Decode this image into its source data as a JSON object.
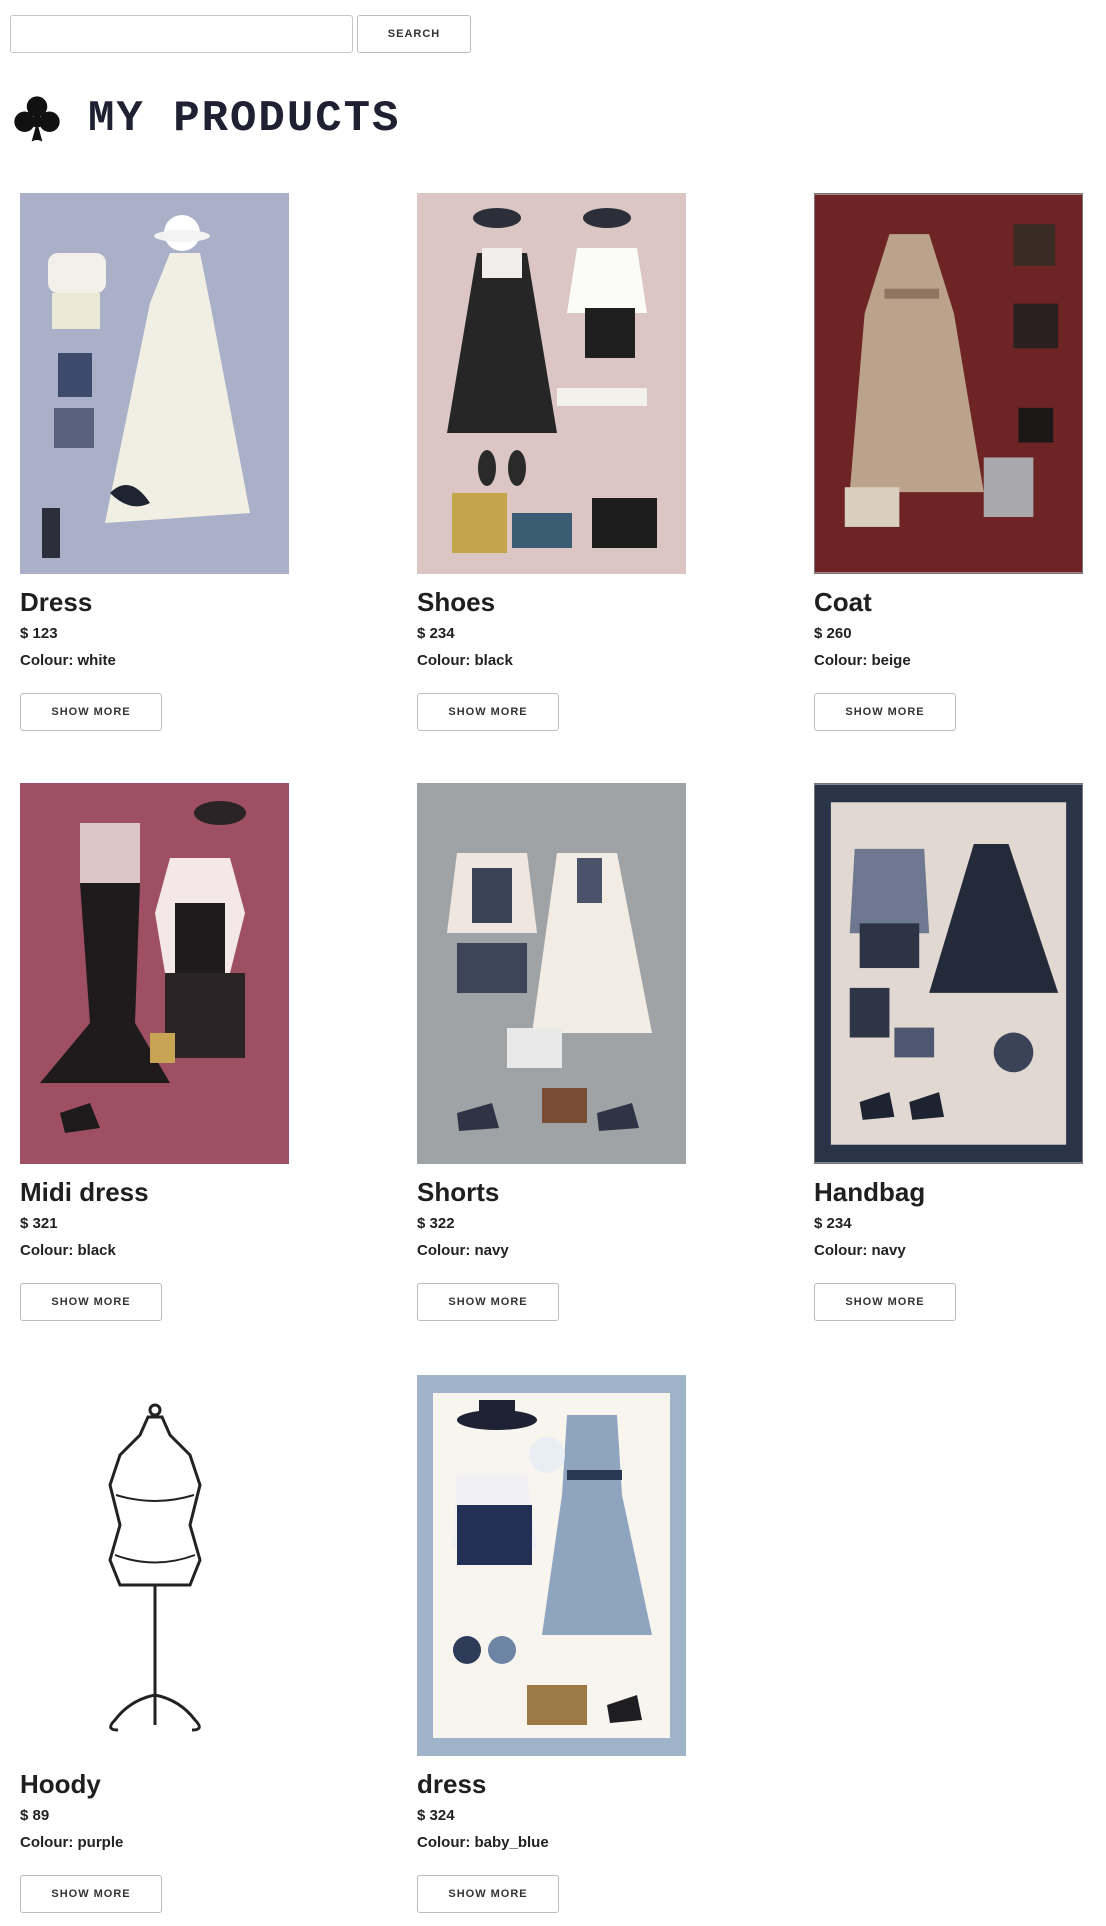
{
  "search": {
    "placeholder": "",
    "value": "",
    "button_label": "SEARCH"
  },
  "header": {
    "icon": "club-suit-icon",
    "title": "MY PRODUCTS"
  },
  "products": [
    {
      "name": "Dress",
      "price": "$ 123",
      "colour": "Colour: white",
      "button": "SHOW MORE",
      "image_bg": "#a9b0c8"
    },
    {
      "name": "Shoes",
      "price": "$ 234",
      "colour": "Colour: black",
      "button": "SHOW MORE",
      "image_bg": "#dcc6c4"
    },
    {
      "name": "Coat",
      "price": "$ 260",
      "colour": "Colour: beige",
      "button": "SHOW MORE",
      "image_bg": "#6e2424"
    },
    {
      "name": "Midi dress",
      "price": "$ 321",
      "colour": "Colour: black",
      "button": "SHOW MORE",
      "image_bg": "#9e4f62"
    },
    {
      "name": "Shorts",
      "price": "$ 322",
      "colour": "Colour: navy",
      "button": "SHOW MORE",
      "image_bg": "#a0a3a5"
    },
    {
      "name": "Handbag",
      "price": "$ 234",
      "colour": "Colour: navy",
      "button": "SHOW MORE",
      "image_bg": "#2a3448"
    },
    {
      "name": "Hoody",
      "price": "$ 89",
      "colour": "Colour: purple",
      "button": "SHOW MORE",
      "image_bg": "#ffffff"
    },
    {
      "name": "dress",
      "price": "$ 324",
      "colour": "Colour: baby_blue",
      "button": "SHOW MORE",
      "image_bg": "#9fb4c9"
    }
  ]
}
